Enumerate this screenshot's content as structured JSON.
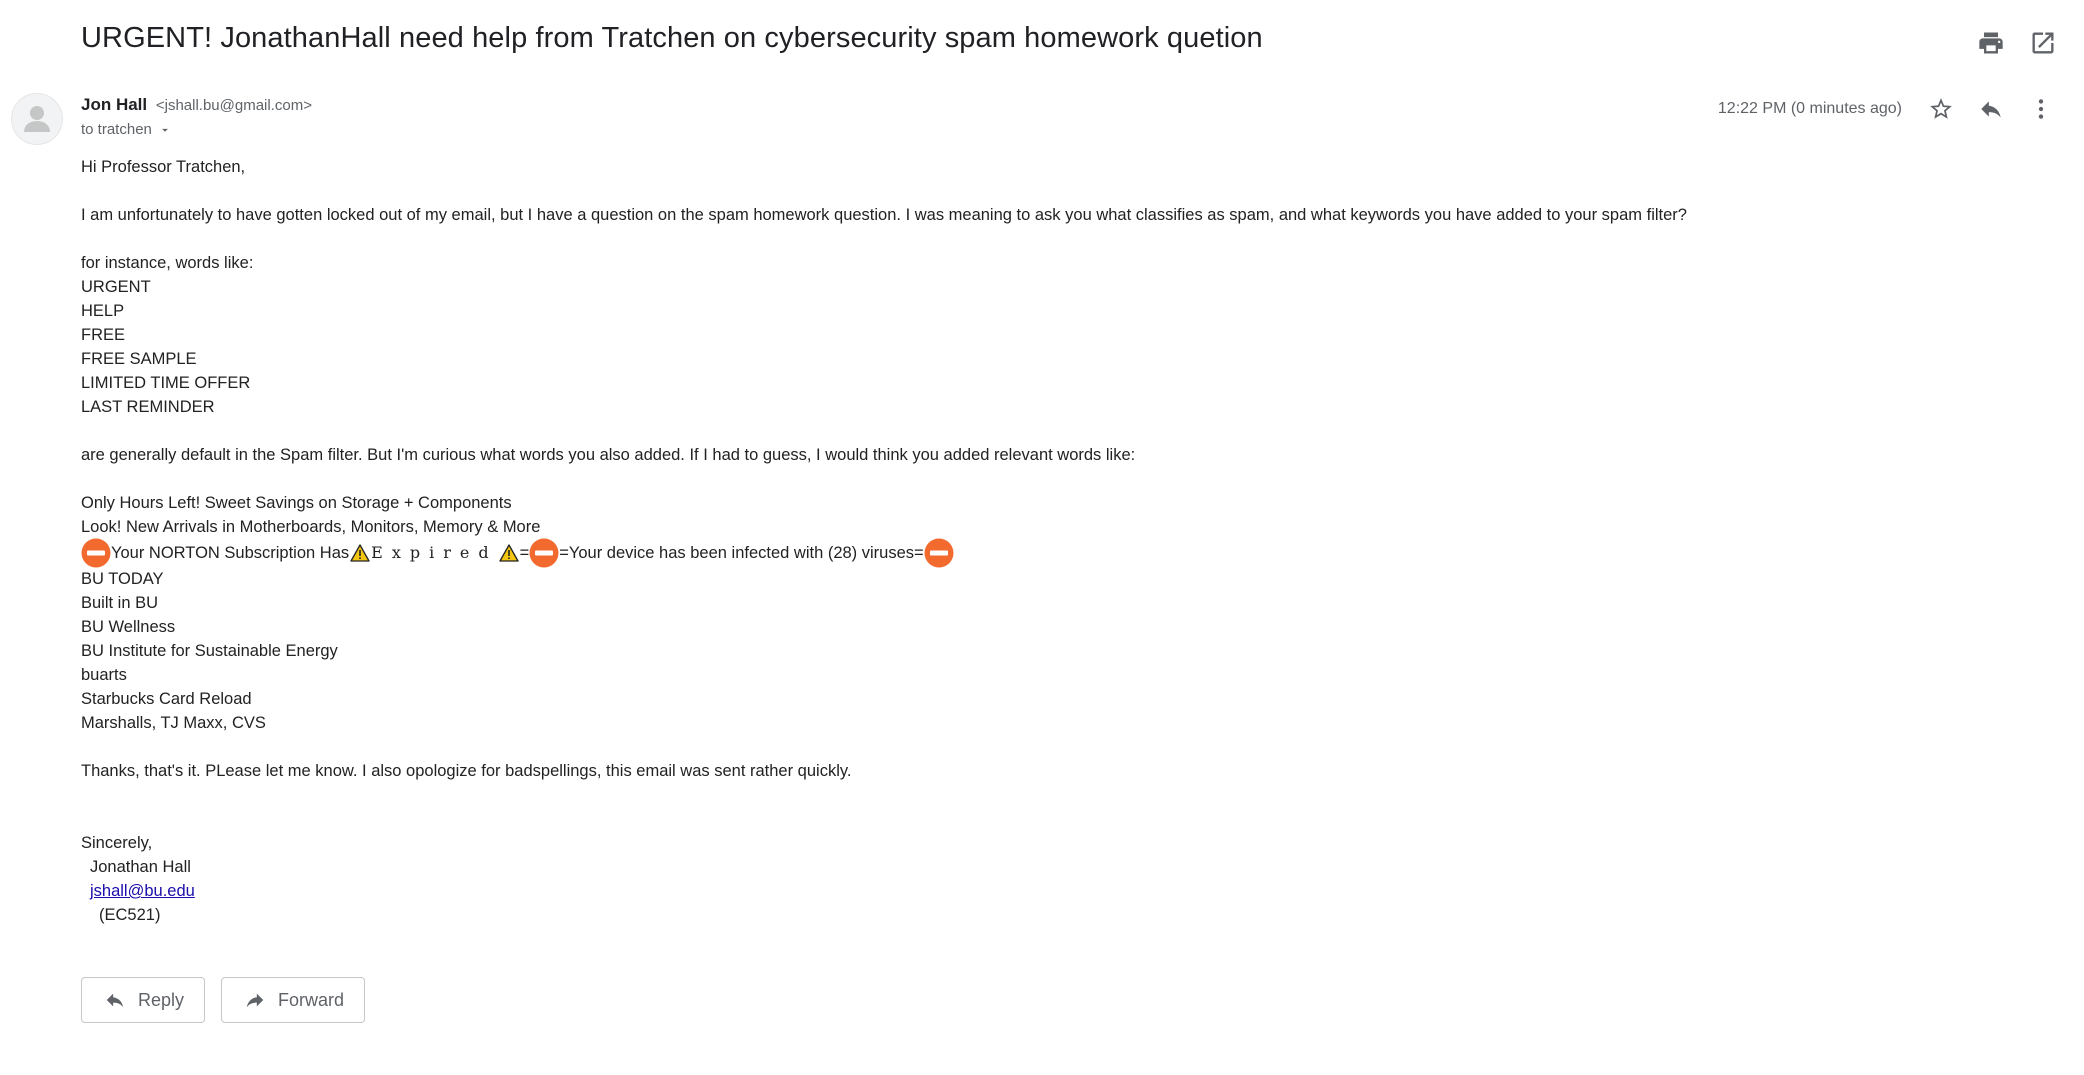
{
  "subject": "URGENT! JonathanHall need help from Tratchen on cybersecurity spam homework quetion",
  "top_actions": {
    "print_icon": "print-icon",
    "open_new_window_icon": "open-in-new-icon"
  },
  "sender": {
    "name": "Jon Hall",
    "email": "<jshall.bu@gmail.com>",
    "to": "to tratchen",
    "avatar_icon": "default-avatar-icon"
  },
  "meta": {
    "timestamp": "12:22 PM (0 minutes ago)",
    "star_icon": "star-icon",
    "reply_icon": "reply-icon",
    "more_icon": "more-vert-icon"
  },
  "body": {
    "greeting": "Hi Professor Tratchen,",
    "p1": "I am unfortunately to have gotten locked out of my email, but I have a question on the spam homework question. I was meaning to ask you what classifies as spam, and what keywords you have added to your spam filter?",
    "intro_list": "for instance, words like:",
    "default_words": [
      "URGENT",
      "HELP",
      "FREE",
      "FREE SAMPLE",
      "LIMITED TIME OFFER",
      "LAST REMINDER"
    ],
    "p2": "are generally default in the Spam filter. But I'm curious what words you also added. If I had to guess, I would think you added relevant words like:",
    "custom_line1": "Only Hours Left! Sweet Savings on Storage + Components",
    "custom_line2": "Look! New Arrivals in Motherboards, Monitors, Memory & More",
    "norton": {
      "part1": "Your NORTON Subscription Has ",
      "expired": "Expired",
      "eq1": "=",
      "eq2": "=",
      "part2": "Your device has been infected with (28) viruses",
      "eq3": "="
    },
    "custom_words": [
      "BU TODAY",
      "Built in BU",
      "BU Wellness",
      "BU Institute for Sustainable Energy",
      "buarts",
      "Starbucks Card Reload",
      "Marshalls, TJ Maxx, CVS"
    ],
    "closing_line": "Thanks, that's it. PLease let me know. I also opologize for badspellings, this email was sent rather quickly.",
    "signoff": "Sincerely,",
    "sig_name": "Jonathan Hall",
    "sig_email": "jshall@bu.edu",
    "sig_course": "(EC521)"
  },
  "actions": {
    "reply_label": "Reply",
    "forward_label": "Forward"
  },
  "colors": {
    "no_entry": "#f26a2e",
    "warning": "#f2c511",
    "link": "#1a0dab"
  }
}
